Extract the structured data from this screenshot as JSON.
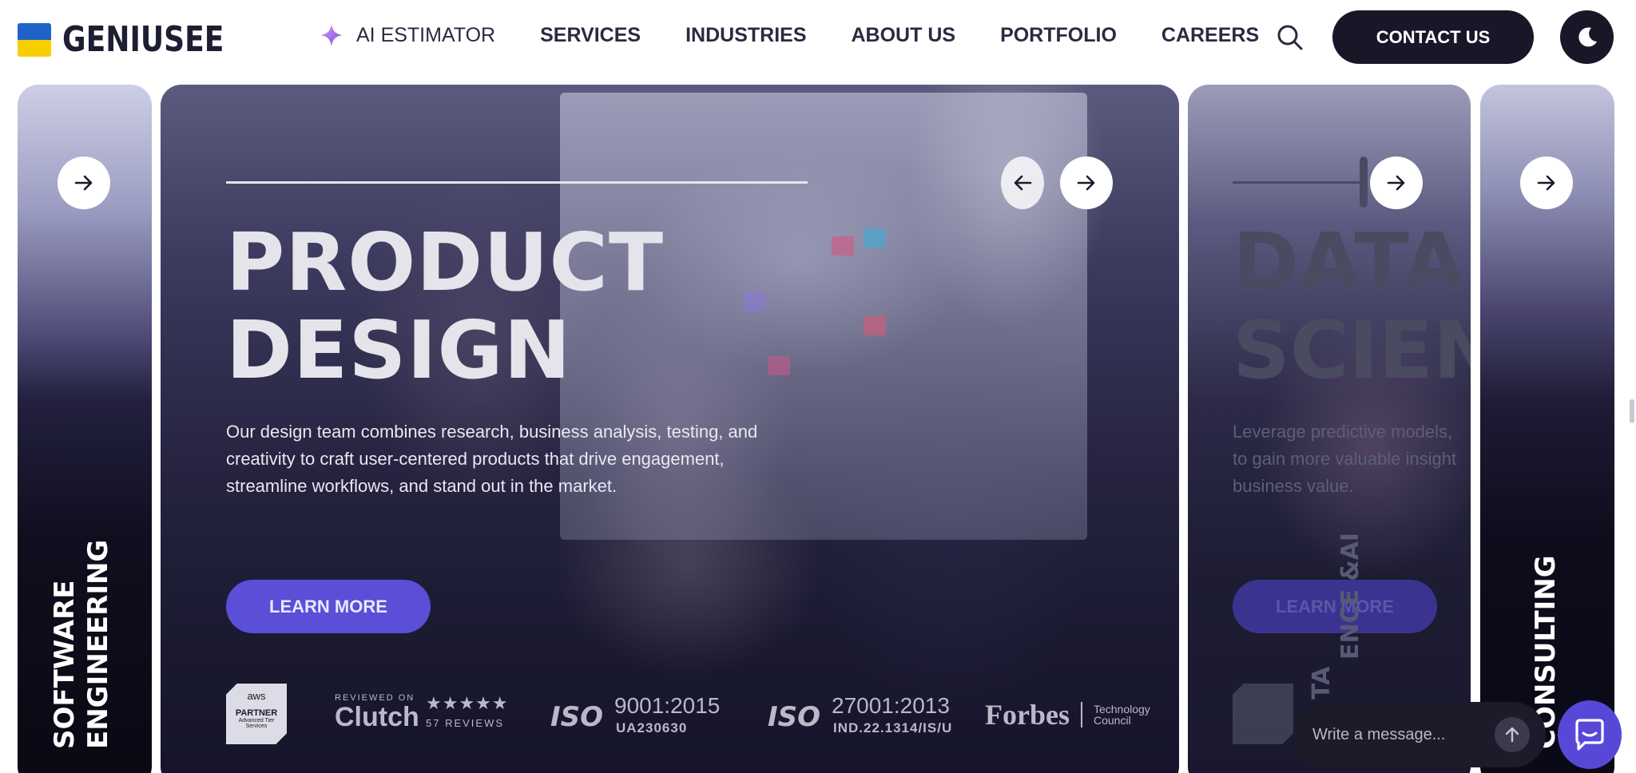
{
  "brand": {
    "name": "GENIUSEE",
    "flag_colors": [
      "#1f63c9",
      "#f7cf00"
    ]
  },
  "nav": {
    "ai_estimator": "AI ESTIMATOR",
    "services": "SERVICES",
    "industries": "INDUSTRIES",
    "about": "ABOUT US",
    "portfolio": "PORTFOLIO",
    "careers": "CAREERS",
    "contact": "CONTACT US",
    "icons": {
      "search": "search-icon",
      "theme": "moon-icon",
      "sparkle": "sparkle-icon"
    }
  },
  "cards": {
    "left": {
      "line1": "SOFTWARE",
      "line2": "ENGINEERING"
    },
    "main": {
      "title_line1": "PRODUCT",
      "title_line2": "DESIGN",
      "description": "Our design team combines research, business analysis, testing, and creativity to craft user-centered products that drive engagement, streamline workflows, and stand out in the market.",
      "desc_lines": [
        "Our design team combines research, business analysis, testing, and",
        "creativity to craft user-centered products that drive engagement,",
        "streamline workflows, and stand out in the market."
      ],
      "cta": "LEARN MORE"
    },
    "data": {
      "title_line1": "DATA",
      "title_line2": "SCIEN",
      "desc_lines": [
        "Leverage predictive models,",
        "to gain more valuable insight",
        "business value."
      ],
      "cta": "LEARN MORE",
      "vertical_a": "ENCE &AI",
      "vertical_b": "TA"
    },
    "consult": {
      "vertical": "CONSULTING"
    }
  },
  "badges": {
    "aws": {
      "brand": "aws",
      "label": "PARTNER",
      "tier": "Advanced Tier",
      "sub": "Services"
    },
    "clutch": {
      "reviewed_on": "REVIEWED ON",
      "word": "Clutch",
      "stars": "★★★★★",
      "reviews": "57 REVIEWS"
    },
    "iso1": {
      "mark": "ISO",
      "standard": "9001:2015",
      "code": "UA230630"
    },
    "iso2": {
      "mark": "ISO",
      "standard": "27001:2013",
      "code": "IND.22.1314/IS/U"
    },
    "forbes": {
      "word": "Forbes",
      "tag1": "Technology",
      "tag2": "Council"
    }
  },
  "chat": {
    "placeholder": "Write a message..."
  },
  "colors": {
    "accent": "#5a4fd6",
    "dark": "#171728"
  }
}
